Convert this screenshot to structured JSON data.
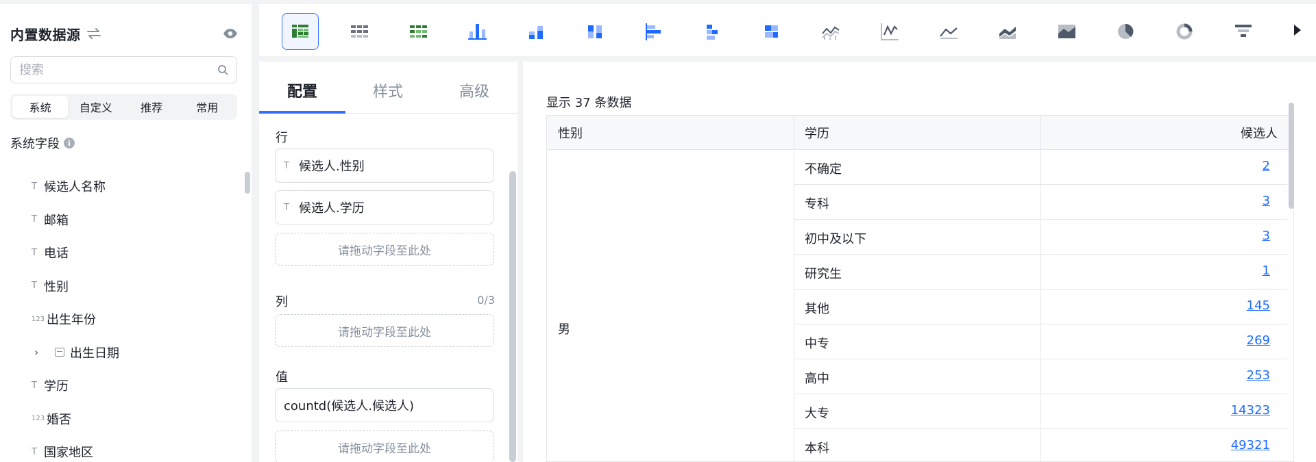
{
  "sidebar": {
    "title": "内置数据源",
    "search_placeholder": "搜索",
    "tabs": [
      "系统",
      "自定义",
      "推荐",
      "常用"
    ],
    "section_title": "系统字段",
    "fields": [
      {
        "type": "T",
        "label": "候选人名称"
      },
      {
        "type": "T",
        "label": "邮箱"
      },
      {
        "type": "T",
        "label": "电话"
      },
      {
        "type": "T",
        "label": "性别"
      },
      {
        "type": "123",
        "label": "出生年份"
      },
      {
        "type": "date",
        "label": "出生日期"
      },
      {
        "type": "T",
        "label": "学历"
      },
      {
        "type": "123",
        "label": "婚否"
      },
      {
        "type": "T",
        "label": "国家地区"
      }
    ]
  },
  "toolbar": {
    "chart_types": [
      "table-icon",
      "grid-icon",
      "grid-colored-icon",
      "bar-icon",
      "stacked-bar-icon",
      "grouped-bar-icon",
      "horizontal-bar-icon",
      "horizontal-stacked-icon",
      "horizontal-grouped-icon",
      "multi-line-icon",
      "line-icon",
      "area-icon",
      "stacked-area-icon",
      "filled-area-icon",
      "pie-icon",
      "donut-icon",
      "funnel-icon"
    ],
    "active_color": "#3370ff"
  },
  "config": {
    "tabs": [
      "配置",
      "样式",
      "高级"
    ],
    "rows_label": "行",
    "row_fields": [
      "候选人.性别",
      "候选人.学历"
    ],
    "drop_hint": "请拖动字段至此处",
    "cols_label": "列",
    "cols_count": "0/3",
    "values_label": "值",
    "value_field": "countd(候选人.候选人)"
  },
  "data": {
    "count_text": "显示 37 条数据",
    "headers": [
      "性别",
      "学历",
      "候选人"
    ],
    "gender": "男",
    "rows": [
      {
        "edu": "不确定",
        "count": "2"
      },
      {
        "edu": "专科",
        "count": "3"
      },
      {
        "edu": "初中及以下",
        "count": "3"
      },
      {
        "edu": "研究生",
        "count": "1"
      },
      {
        "edu": "其他",
        "count": "145"
      },
      {
        "edu": "中专",
        "count": "269"
      },
      {
        "edu": "高中",
        "count": "253"
      },
      {
        "edu": "大专",
        "count": "14323"
      },
      {
        "edu": "本科",
        "count": "49321"
      }
    ],
    "link_color": "#1f6bff"
  }
}
